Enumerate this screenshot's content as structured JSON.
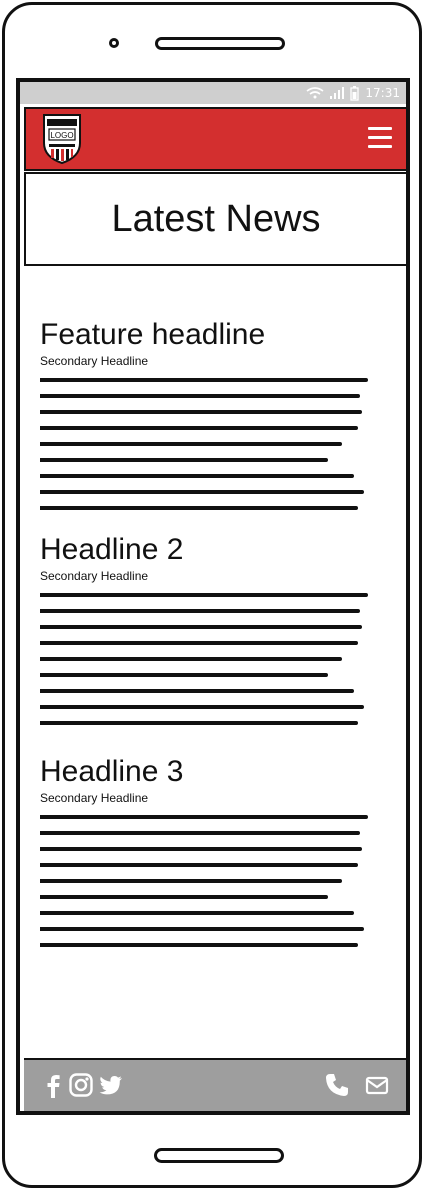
{
  "status_bar": {
    "time": "17:31"
  },
  "header": {
    "logo_text": "LOGO",
    "menu_icon": "hamburger-menu-icon"
  },
  "page": {
    "title": "Latest News"
  },
  "articles": [
    {
      "headline": "Feature headline",
      "secondary": "Secondary Headline"
    },
    {
      "headline": "Headline 2",
      "secondary": "Secondary Headline"
    },
    {
      "headline": "Headline 3",
      "secondary": "Secondary Headline"
    }
  ],
  "footer": {
    "social_icons": [
      "facebook-icon",
      "instagram-icon",
      "twitter-icon"
    ],
    "contact_icons": [
      "phone-icon",
      "mail-icon"
    ]
  },
  "colors": {
    "header_red": "#d32f2f",
    "footer_grey": "#9e9e9e",
    "status_grey": "#cfcfcf"
  }
}
